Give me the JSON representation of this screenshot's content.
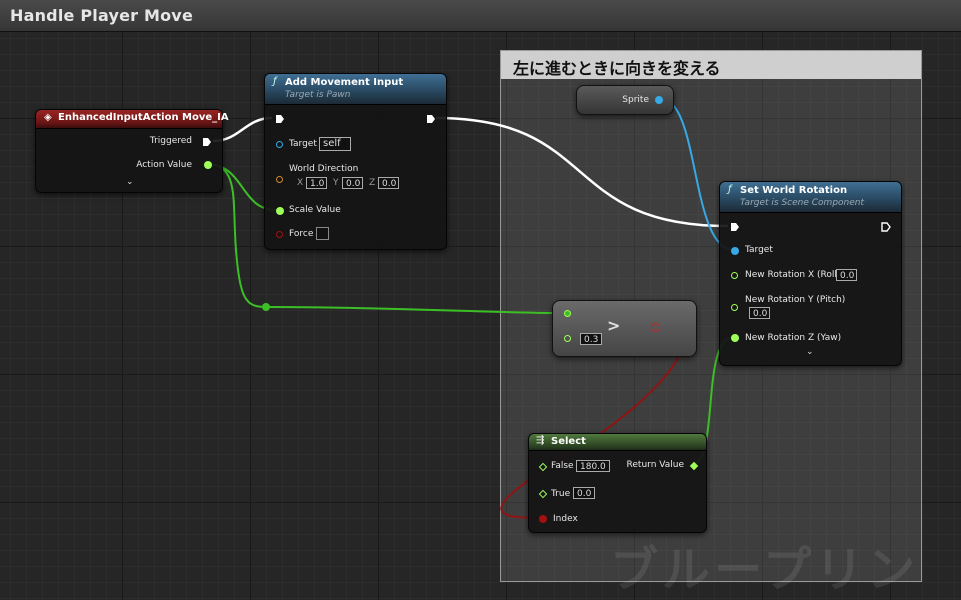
{
  "graph": {
    "title": "Handle Player Move",
    "comment_title": "左に進むときに向きを変える",
    "watermark": "ブループリン"
  },
  "nodes": {
    "enhanced_input": {
      "title": "EnhancedInputAction Move_IA",
      "pins": {
        "triggered": "Triggered",
        "action_value": "Action Value"
      }
    },
    "add_movement": {
      "title": "Add Movement Input",
      "subtitle": "Target is Pawn",
      "pins": {
        "target": "Target",
        "target_value": "self",
        "world_direction": "World Direction",
        "x_label": "X",
        "x_value": "1.0",
        "y_label": "Y",
        "y_value": "0.0",
        "z_label": "Z",
        "z_value": "0.0",
        "scale_value": "Scale Value",
        "force": "Force"
      }
    },
    "sprite": {
      "label": "Sprite"
    },
    "set_world_rotation": {
      "title": "Set World Rotation",
      "subtitle": "Target is Scene Component",
      "pins": {
        "target": "Target",
        "roll": "New Rotation X (Roll)",
        "roll_value": "0.0",
        "pitch": "New Rotation Y (Pitch)",
        "pitch_value": "0.0",
        "yaw": "New Rotation Z (Yaw)"
      }
    },
    "greater": {
      "symbol": ">",
      "b_value": "0.3"
    },
    "select": {
      "title": "Select",
      "pins": {
        "false": "False",
        "false_value": "180.0",
        "true": "True",
        "true_value": "0.0",
        "return_value": "Return Value",
        "index": "Index"
      }
    }
  },
  "colors": {
    "exec": "#ffffff",
    "float": "#9dff57",
    "float_wire": "#3cbf26",
    "object": "#36a9e6",
    "bool": "#a31010",
    "vector": "#d1872e",
    "event_header": "#8a1f1f",
    "function_header": "#3f6f94",
    "pure_header": "#4f7a3d"
  }
}
